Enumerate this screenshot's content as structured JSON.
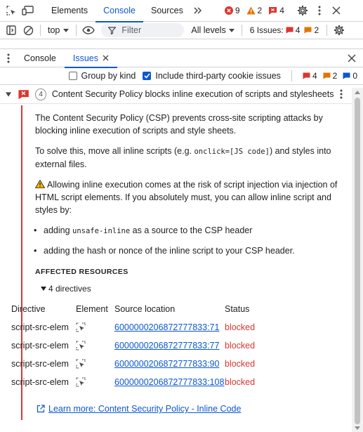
{
  "toolbar": {
    "tabs": [
      "Elements",
      "Console",
      "Sources"
    ],
    "active_tab": "Console",
    "error_count": "9",
    "warning_count": "2",
    "issue_count": "4"
  },
  "console_bar": {
    "context": "top",
    "filter_placeholder": "Filter",
    "levels": "All levels",
    "issues_label": "6 Issues:",
    "issues_errors": "4",
    "issues_warnings": "2"
  },
  "drawer": {
    "tabs": [
      "Console",
      "Issues"
    ],
    "active_tab": "Issues"
  },
  "issues_toolbar": {
    "group_by_kind": "Group by kind",
    "third_party": "Include third-party cookie issues",
    "errors": "4",
    "warnings": "2",
    "info": "0"
  },
  "issue": {
    "count": "4",
    "title": "Content Security Policy blocks inline execution of scripts and stylesheets",
    "intro": "The Content Security Policy (CSP) prevents cross-site scripting attacks by blocking inline execution of scripts and style sheets.",
    "solve_pre": "To solve this, move all inline scripts (e.g. ",
    "solve_code": "onclick=[JS code]",
    "solve_post": ") and styles into external files.",
    "warning_text": "Allowing inline execution comes at the risk of script injection via injection of HTML script elements. If you absolutely must, you can allow inline script and styles by:",
    "bullet1_pre": "adding ",
    "bullet1_code": "unsafe-inline",
    "bullet1_post": " as a source to the CSP header",
    "bullet2": "adding the hash or nonce of the inline script to your CSP header.",
    "affected_label": "AFFECTED RESOURCES",
    "directives_label": "4 directives",
    "table_headers": [
      "Directive",
      "Element",
      "Source location",
      "Status"
    ],
    "rows": [
      {
        "directive": "script-src-elem",
        "source": "6000000206872777833:71",
        "status": "blocked"
      },
      {
        "directive": "script-src-elem",
        "source": "6000000206872777833:77",
        "status": "blocked"
      },
      {
        "directive": "script-src-elem",
        "source": "6000000206872777833:90",
        "status": "blocked"
      },
      {
        "directive": "script-src-elem",
        "source": "6000000206872777833:108",
        "status": "blocked"
      }
    ],
    "learn_more": "Learn more: Content Security Policy - Inline Code"
  },
  "colors": {
    "accent": "#0b57d0",
    "error": "#dc362e",
    "warning": "#e37400"
  }
}
